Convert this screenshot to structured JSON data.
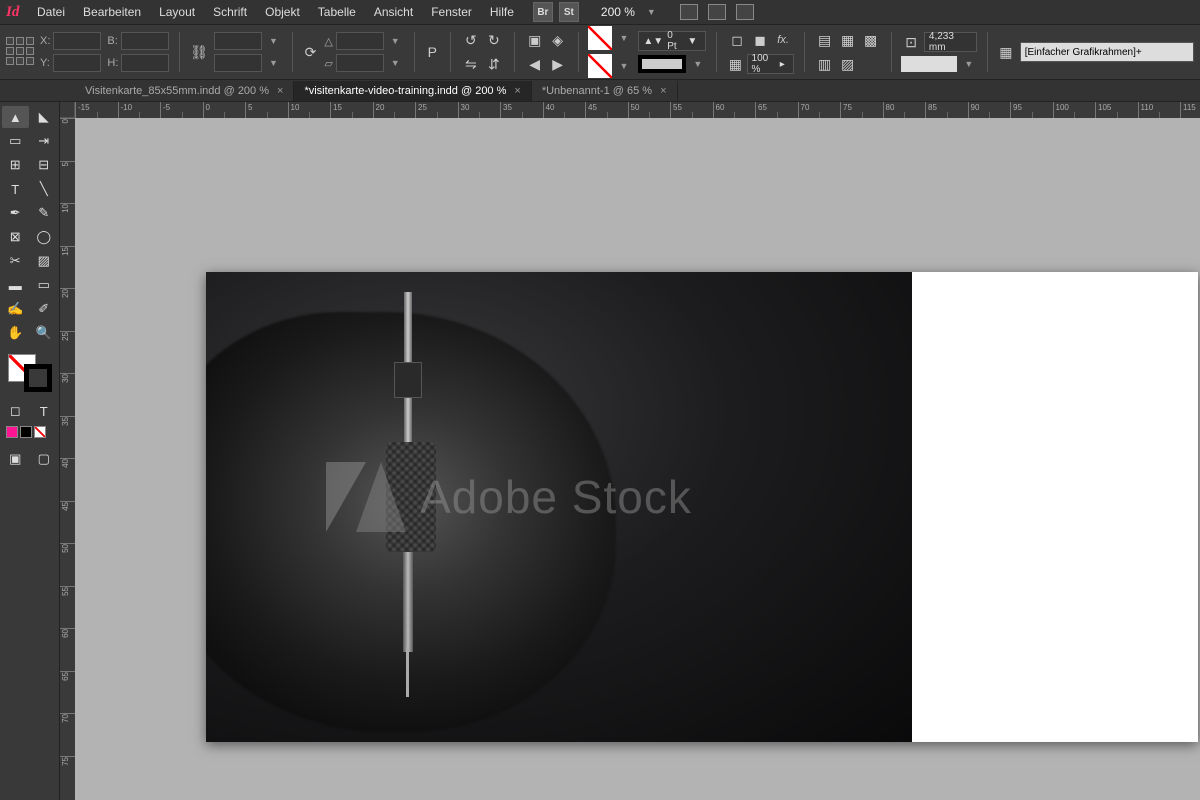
{
  "app": {
    "brand": "Id"
  },
  "menu": {
    "items": [
      "Datei",
      "Bearbeiten",
      "Layout",
      "Schrift",
      "Objekt",
      "Tabelle",
      "Ansicht",
      "Fenster",
      "Hilfe"
    ],
    "bridge_label": "Br",
    "stock_label": "St",
    "zoom": "200 %"
  },
  "control": {
    "x_label": "X:",
    "y_label": "Y:",
    "w_label": "B:",
    "h_label": "H:",
    "stroke_weight": "0 Pt",
    "opacity": "100 %",
    "ref_dim": "4,233 mm",
    "style": "[Einfacher Grafikrahmen]+"
  },
  "tabs": [
    {
      "label": "Visitenkarte_85x55mm.indd @ 200 %",
      "active": false
    },
    {
      "label": "*visitenkarte-video-training.indd @ 200 %",
      "active": true
    },
    {
      "label": "*Unbenannt-1 @ 65 %",
      "active": false
    }
  ],
  "ruler_h": [
    "-15",
    "-10",
    "-5",
    "0",
    "5",
    "10",
    "15",
    "20",
    "25",
    "30",
    "35",
    "40",
    "45",
    "50",
    "55",
    "60",
    "65",
    "70",
    "75",
    "80",
    "85",
    "90",
    "95",
    "100",
    "105",
    "110",
    "115"
  ],
  "ruler_v": [
    "0",
    "5",
    "10",
    "15",
    "20",
    "25",
    "30",
    "35",
    "40",
    "45",
    "50",
    "55",
    "60",
    "65",
    "70",
    "75"
  ],
  "canvas": {
    "watermark_text": "Adobe Stock"
  }
}
